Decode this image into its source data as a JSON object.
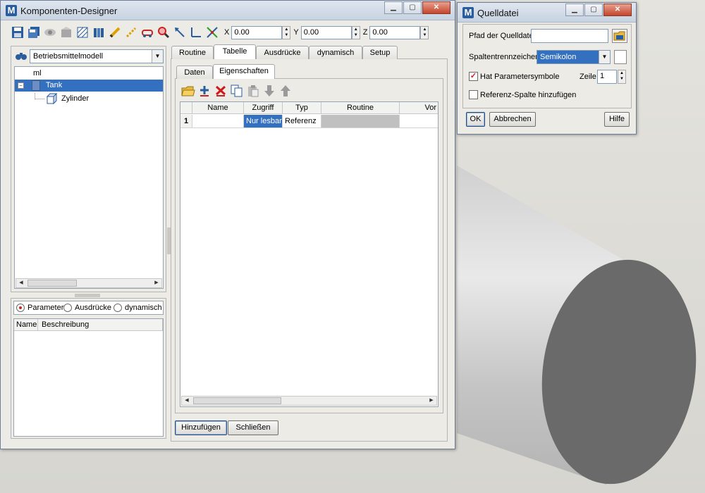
{
  "designer": {
    "title": "Komponenten-Designer",
    "app_icon": "M",
    "window_buttons": {
      "minimize": "▁",
      "maximize": "▢",
      "close": "✕"
    },
    "toolbar": {
      "icons": [
        "save-icon",
        "save-copy-icon",
        "view-icon",
        "package-icon",
        "hatch-icon",
        "layers-icon",
        "pencil-icon",
        "dashed-pencil-icon",
        "link-icon",
        "zoom-icon",
        "arrow-icon",
        "axis-icon",
        "scale-icon"
      ],
      "x_label": "X",
      "x_value": "0.00",
      "y_label": "Y",
      "y_value": "0.00",
      "z_label": "Z",
      "z_value": "0.00"
    },
    "tree": {
      "model_select": "Betriebsmittelmodell",
      "items": [
        {
          "label": "ml"
        },
        {
          "label": "Tank",
          "selected": true
        },
        {
          "label": "Zylinder"
        }
      ]
    },
    "param_panel": {
      "radio_parameter": "Parameter",
      "radio_ausdruecke": "Ausdrücke",
      "radio_dynamisch": "dynamisch",
      "col_name": "Name",
      "col_beschreibung": "Beschreibung"
    },
    "tabs": [
      "Routine",
      "Tabelle",
      "Ausdrücke",
      "dynamisch",
      "Setup"
    ],
    "active_tab": "Tabelle",
    "subtabs": [
      "Daten",
      "Eigenschaften"
    ],
    "active_subtab": "Eigenschaften",
    "grid": {
      "columns": [
        "Name",
        "Zugriff",
        "Typ",
        "Routine",
        "Vor"
      ],
      "rows": [
        {
          "num": "1",
          "name": "",
          "zugriff": "Nur lesbar",
          "typ": "Referenz",
          "routine": "",
          "vor": ""
        }
      ]
    },
    "buttons": {
      "add": "Hinzufügen",
      "close": "Schließen"
    }
  },
  "quelldatei": {
    "title": "Quelldatei",
    "app_icon": "M",
    "pfad_label": "Pfad der Quelldatei",
    "pfad_value": "",
    "spalten_label": "Spaltentrennzeichen",
    "spalten_value": "Semikolon",
    "hat_param_label": "Hat Parametersymbole",
    "hat_param_checked": true,
    "zeile_label": "Zeile",
    "zeile_value": "1",
    "ref_spalte_label": "Referenz-Spalte hinzufügen",
    "ref_spalte_checked": false,
    "ok": "OK",
    "abbrechen": "Abbrechen",
    "hilfe": "Hilfe"
  },
  "colors": {
    "selection": "#3370c0",
    "accent": "#2a5d9e"
  }
}
